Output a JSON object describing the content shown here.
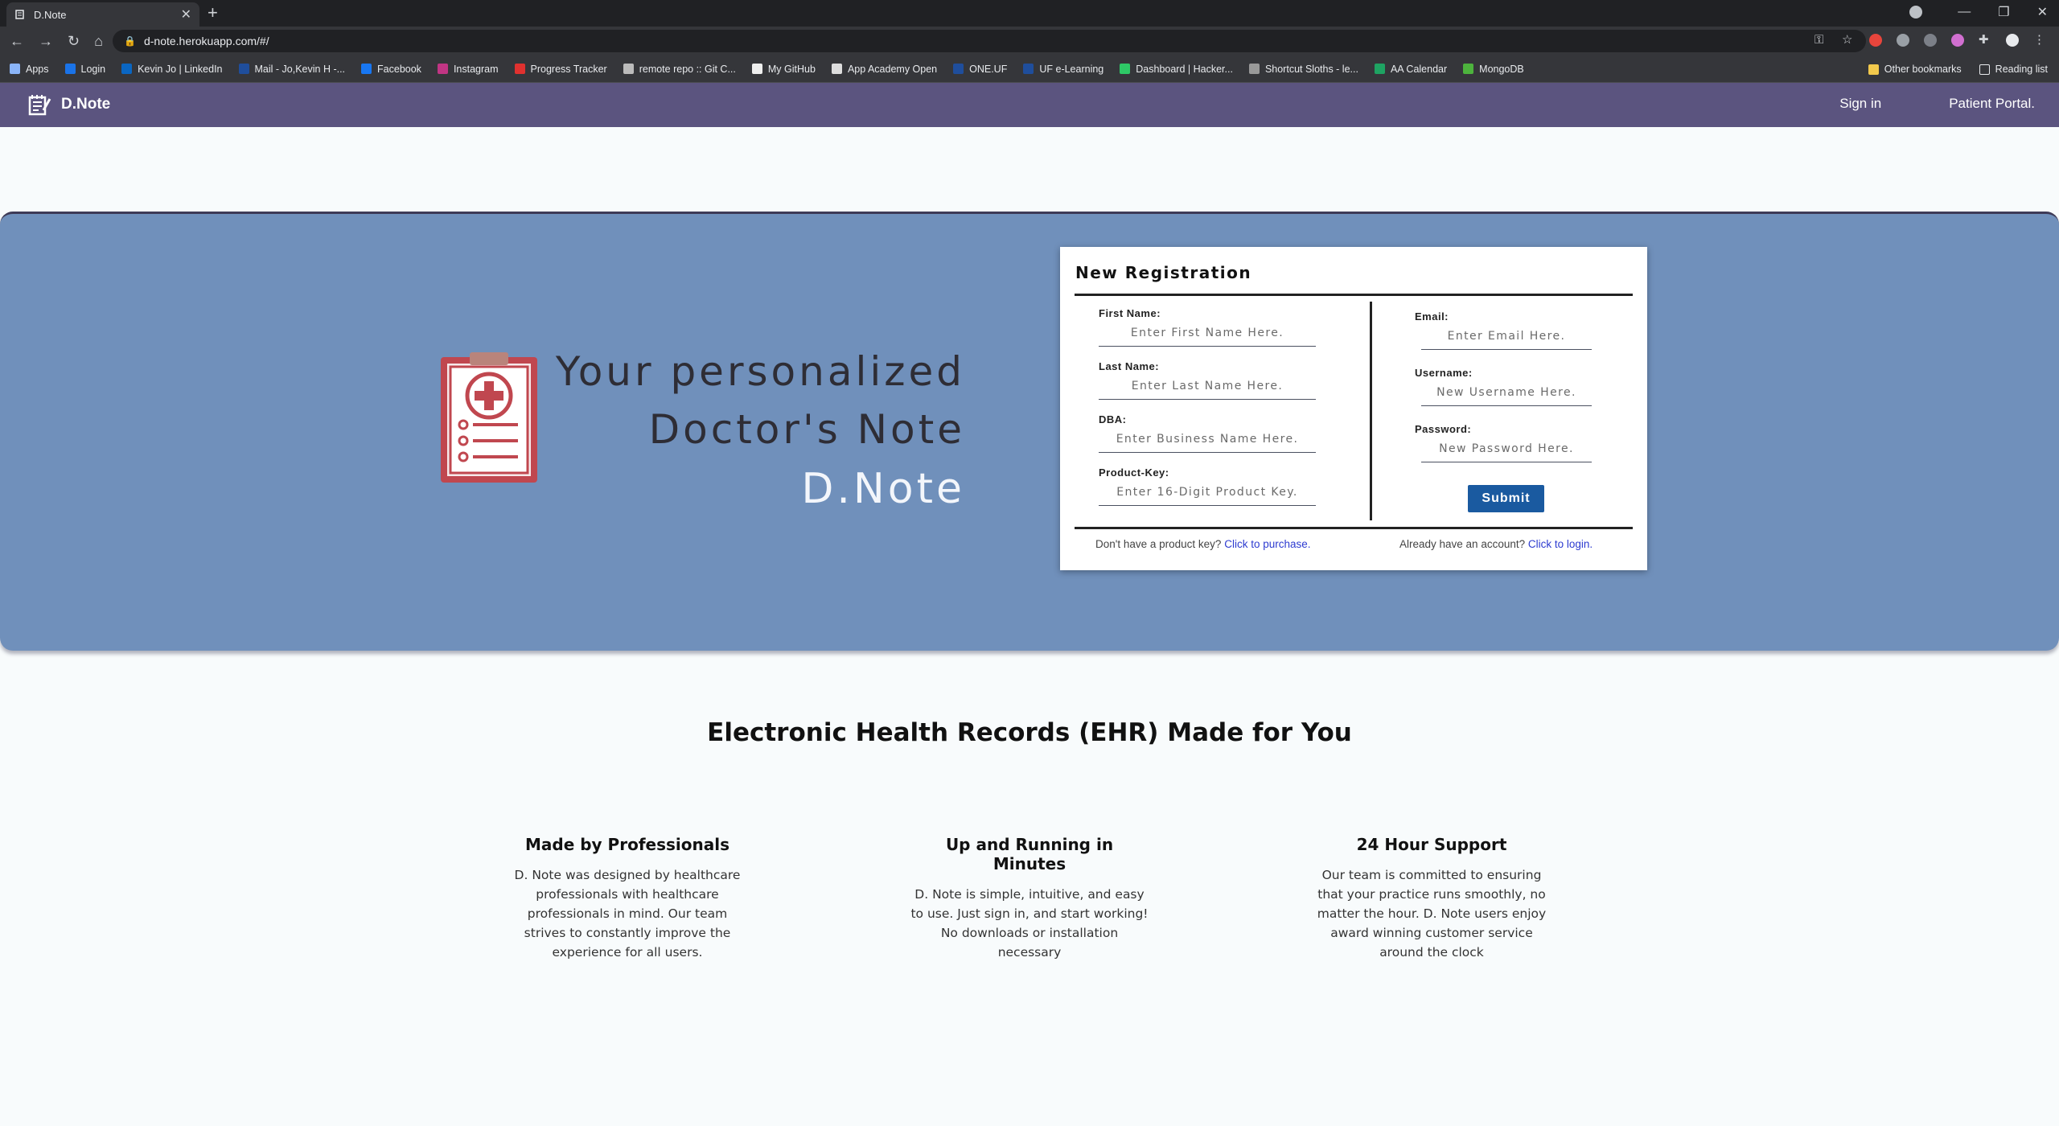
{
  "browser": {
    "tab_title": "D.Note",
    "url": "d-note.herokuapp.com/#/",
    "bookmarks": [
      {
        "label": "Apps",
        "color": "#8ab4f8"
      },
      {
        "label": "Login",
        "color": "#1a73e8"
      },
      {
        "label": "Kevin Jo | LinkedIn",
        "color": "#0a66c2"
      },
      {
        "label": "Mail - Jo,Kevin H -...",
        "color": "#1f4e9c"
      },
      {
        "label": "Facebook",
        "color": "#1877f2"
      },
      {
        "label": "Instagram",
        "color": "#c13584"
      },
      {
        "label": "Progress Tracker",
        "color": "#e0312f"
      },
      {
        "label": "remote repo :: Git C...",
        "color": "#bbbbbb"
      },
      {
        "label": "My GitHub",
        "color": "#eeeeee"
      },
      {
        "label": "App Academy Open",
        "color": "#dddddd"
      },
      {
        "label": "ONE.UF",
        "color": "#1f4e9c"
      },
      {
        "label": "UF e-Learning",
        "color": "#1f4e9c"
      },
      {
        "label": "Dashboard | Hacker...",
        "color": "#2ec866"
      },
      {
        "label": "Shortcut Sloths - le...",
        "color": "#999999"
      },
      {
        "label": "AA Calendar",
        "color": "#1ea362"
      },
      {
        "label": "MongoDB",
        "color": "#4db33d"
      }
    ],
    "other_bookmarks": "Other bookmarks",
    "reading_list": "Reading list"
  },
  "nav": {
    "brand": "D.Note",
    "sign_in": "Sign in",
    "patient_portal": "Patient Portal."
  },
  "hero": {
    "line1": "Your personalized",
    "line2": "Doctor's Note",
    "line3": "D.Note"
  },
  "registration": {
    "title": "New Registration",
    "first_name_label": "First Name:",
    "first_name_placeholder": "Enter First Name Here.",
    "last_name_label": "Last Name:",
    "last_name_placeholder": "Enter Last Name Here.",
    "dba_label": "DBA:",
    "dba_placeholder": "Enter Business Name Here.",
    "product_key_label": "Product-Key:",
    "product_key_placeholder": "Enter 16-Digit Product Key.",
    "email_label": "Email:",
    "email_placeholder": "Enter Email Here.",
    "username_label": "Username:",
    "username_placeholder": "New Username Here.",
    "password_label": "Password:",
    "password_placeholder": "New Password Here.",
    "submit": "Submit",
    "no_key_text": "Don't have a product key?",
    "purchase_link": "Click to purchase.",
    "have_account_text": "Already have an account?",
    "login_link": "Click to login."
  },
  "features": {
    "title": "Electronic Health Records (EHR) Made for You",
    "items": [
      {
        "heading": "Made by Professionals",
        "body": "D. Note was designed by healthcare professionals with healthcare professionals in mind. Our team strives to constantly improve the experience for all users."
      },
      {
        "heading": "Up and Running in Minutes",
        "body": "D. Note is simple, intuitive, and easy to use. Just sign in, and start working! No downloads or installation necessary"
      },
      {
        "heading": "24 Hour Support",
        "body": "Our team is committed to ensuring that your practice runs smoothly, no matter the hour. D. Note users enjoy award winning customer service around the clock"
      }
    ]
  },
  "colors": {
    "navbar": "#5b547f",
    "hero": "#7090bb",
    "submit": "#1a5aa0",
    "link": "#2d3bd0",
    "clipboard": "#c0474f"
  }
}
